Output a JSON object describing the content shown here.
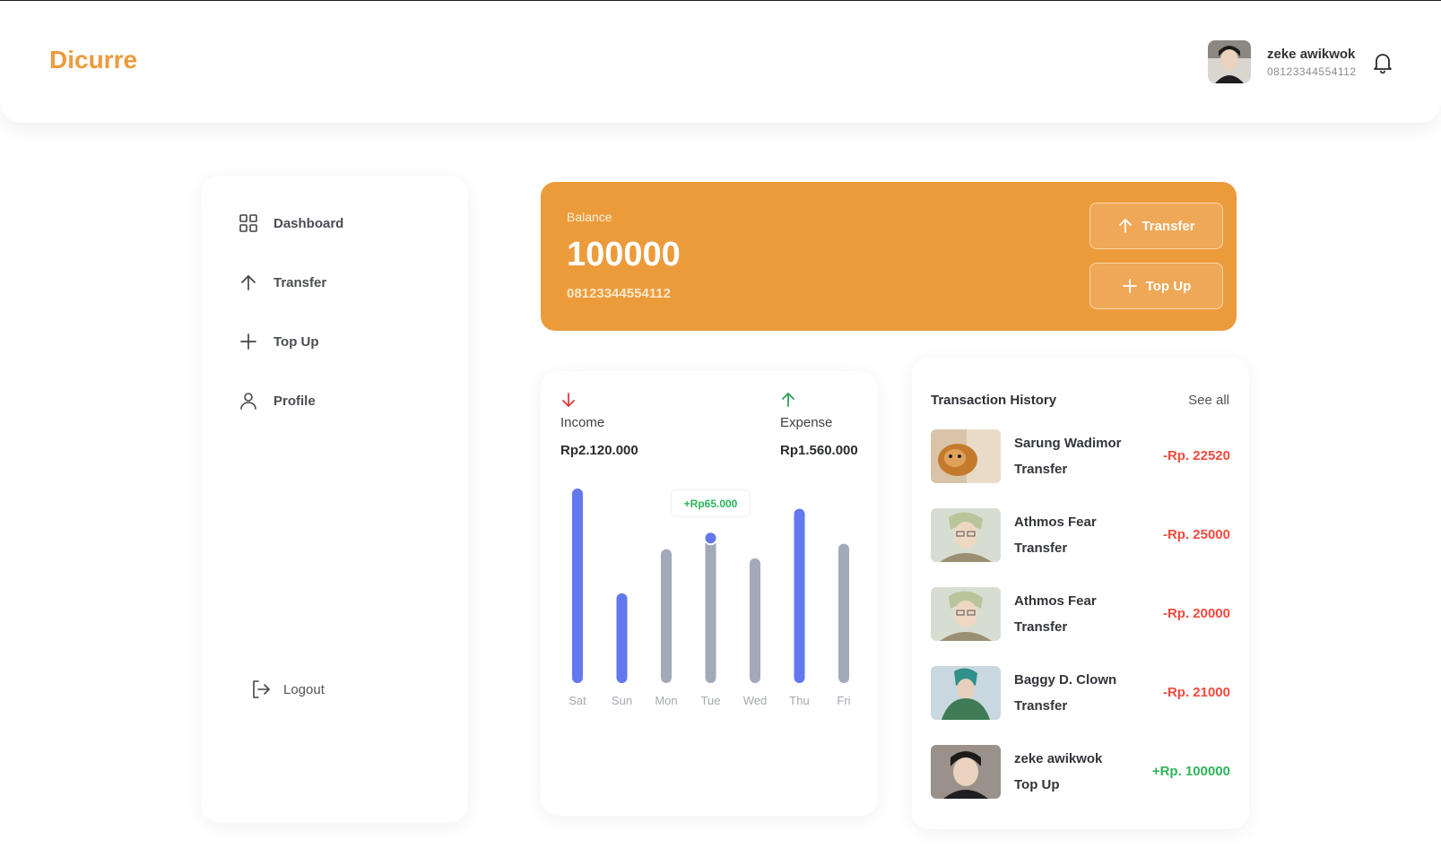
{
  "app": {
    "logo": "Dicurre"
  },
  "user": {
    "name": "zeke awikwok",
    "phone": "08123344554112"
  },
  "sidebar": {
    "items": [
      {
        "label": "Dashboard",
        "icon": "grid-icon"
      },
      {
        "label": "Transfer",
        "icon": "arrow-up-icon"
      },
      {
        "label": "Top Up",
        "icon": "plus-icon"
      },
      {
        "label": "Profile",
        "icon": "user-icon"
      }
    ],
    "logout": "Logout"
  },
  "balance": {
    "label": "Balance",
    "amount": "100000",
    "phone": "08123344554112",
    "transfer_label": "Transfer",
    "topup_label": "Top Up",
    "card_color": "#ec9b3b"
  },
  "stats": {
    "income": {
      "label": "Income",
      "value": "Rp2.120.000",
      "color": "#e23b3b"
    },
    "expense": {
      "label": "Expense",
      "value": "Rp1.560.000",
      "color": "#2f9e5a"
    }
  },
  "chart_data": {
    "type": "bar",
    "categories": [
      "Sat",
      "Sun",
      "Mon",
      "Tue",
      "Wed",
      "Thu",
      "Fri"
    ],
    "values": [
      100,
      43,
      67,
      76,
      62,
      89,
      70
    ],
    "highlighted": [
      true,
      true,
      false,
      false,
      false,
      true,
      false
    ],
    "colors": {
      "highlight": "#6377ee",
      "normal": "#a2aab9"
    },
    "tooltip": {
      "category": "Tue",
      "label": "+Rp65.000"
    }
  },
  "transactions": {
    "title": "Transaction History",
    "see_all": "See all",
    "items": [
      {
        "name": "Sarung Wadimor",
        "type": "Transfer",
        "amount": "-Rp. 22520",
        "color": "#f04a3e"
      },
      {
        "name": "Athmos Fear",
        "type": "Transfer",
        "amount": "-Rp. 25000",
        "color": "#f04a3e"
      },
      {
        "name": "Athmos Fear",
        "type": "Transfer",
        "amount": "-Rp. 20000",
        "color": "#f04a3e"
      },
      {
        "name": "Baggy D. Clown",
        "type": "Transfer",
        "amount": "-Rp. 21000",
        "color": "#f04a3e"
      },
      {
        "name": "zeke awikwok",
        "type": "Top Up",
        "amount": "+Rp. 100000",
        "color": "#2fb45a"
      }
    ]
  }
}
